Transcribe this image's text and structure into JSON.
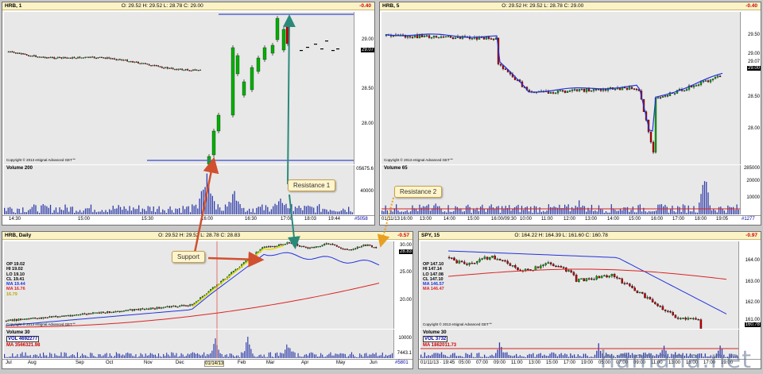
{
  "panels": {
    "hrb1": {
      "symbol": "HRB, 1",
      "ohlc": "O: 29.52   H: 29.52   L: 28.78   C: 29.00",
      "change": "-0.40",
      "price_labels": [
        "29.00",
        "28.50",
        "28.00"
      ],
      "last_price": "29.07",
      "copyright": "Copyright © 2013 eSignal Advanced GET℠",
      "volume_label": "Volume 200",
      "volume_axis": [
        "05675.6",
        "40000"
      ],
      "time_labels": [
        "14:30",
        "15:00",
        "15:30",
        "16:00",
        "16:30",
        "17:00",
        "18:03",
        "19:44"
      ],
      "bar_count": "#5058"
    },
    "hrb5": {
      "symbol": "HRB, 5",
      "ohlc": "O: 29.52   H: 29.52   L: 28.78   C: 29.00",
      "change": "-0.40",
      "price_labels": [
        "29.50",
        "29.00",
        "28.50",
        "28.00"
      ],
      "last_price": "29.07",
      "last_price2": "29.00",
      "copyright": "Copyright © 2013 eSignal Advanced GET℠",
      "volume_label": "Volume 65",
      "volume_axis": [
        "285000",
        "20000",
        "10000"
      ],
      "time_labels": [
        "01/11/13",
        "16:00",
        "13:00",
        "14:00",
        "15:00",
        "16:00/09:30",
        "10:00",
        "11:00",
        "12:00",
        "13:00",
        "14:00",
        "15:00",
        "16:00",
        "17:00",
        "18:00",
        "19:05"
      ],
      "bar_count": "#1277"
    },
    "hrbDaily": {
      "symbol": "HRB, Daily",
      "ohlc": "O: 29.52   H: 29.52   L: 28.78   C: 28.83",
      "change": "-0.57",
      "legend": {
        "op": "OP 19.02",
        "hi": "HI  19.02",
        "lo": "LO 19.10",
        "cl": "CL 19.41",
        "ma1": "MA 19.44",
        "ma2": "MA 16.76",
        "ma3": "16.79"
      },
      "price_labels": [
        "25.00",
        "20.00"
      ],
      "last_price": "28.83",
      "top_price": "30.00",
      "copyright": "Copyright © 2013 eSignal Advanced GET℠",
      "volume_label": "Volume 30",
      "vol_value": "VOL 4692277",
      "vol_ma": "MA  3566321.98",
      "volume_axis": [
        "10000",
        "7443.1"
      ],
      "date_tag": "01/14/13",
      "time_labels": [
        "Jul",
        "Aug",
        "Sep",
        "Oct",
        "Nov",
        "Dec",
        "Feb",
        "Mar",
        "Apr",
        "May",
        "Jun"
      ],
      "bar_count": "#5801"
    },
    "spy15": {
      "symbol": "SPY, 15",
      "ohlc": "O: 164.22   H: 164.39   L: 161.60   C: 160.78",
      "change": "-0.97",
      "legend": {
        "op": "OP 147.10",
        "hi": "HI  147.14",
        "lo": "LO 147.08",
        "cl": "CL 147.10",
        "ma1": "MA 146.57",
        "ma2": "MA 146.47"
      },
      "price_labels": [
        "164.00",
        "163.00",
        "162.00",
        "161.00"
      ],
      "last_price": "160.78",
      "copyright": "Copyright © 2013 eSignal Advanced GET℠",
      "volume_label": "Volume 30",
      "vol_value": "VOL 3732",
      "vol_ma": "MA  1862011.73",
      "time_labels": [
        "01/11/13 · 19:45",
        "05:00",
        "07:00",
        "09:00",
        "11:00",
        "13:00",
        "15:00",
        "17:00",
        "19:00",
        "05:00",
        "07:00",
        "09:00",
        "11:00",
        "13:00",
        "15:00",
        "17:00",
        "19:00"
      ]
    }
  },
  "annotations": {
    "support": "Support",
    "resistance1": "Resistance 1",
    "resistance2": "Resistance 2"
  },
  "colors": {
    "bull": "#00b000",
    "bear": "#c00000",
    "ma_blue": "#2233dd",
    "ma_red": "#dd2222",
    "ma_yellow": "#e6d800",
    "arrow_red": "#d05030",
    "arrow_teal": "#2a8a7a",
    "arrow_orange": "#e8a020"
  },
  "watermark": "hamana.net"
}
